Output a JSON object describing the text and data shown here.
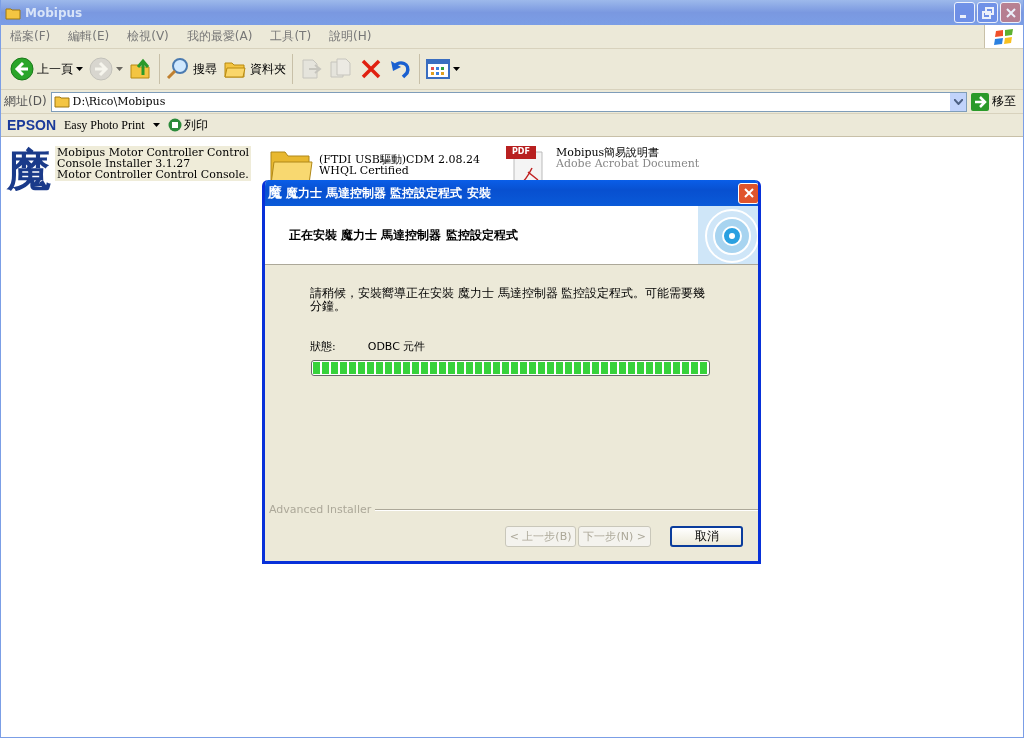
{
  "window": {
    "title": "Mobipus",
    "active": false
  },
  "menu": [
    {
      "label": "檔案(F)"
    },
    {
      "label": "編輯(E)"
    },
    {
      "label": "檢視(V)"
    },
    {
      "label": "我的最愛(A)"
    },
    {
      "label": "工具(T)"
    },
    {
      "label": "說明(H)"
    }
  ],
  "toolbar": [
    {
      "kind": "back",
      "label": "上一頁",
      "disabled": false
    },
    {
      "kind": "forward",
      "disabled": true
    },
    {
      "kind": "up",
      "disabled": false
    },
    {
      "kind": "search",
      "label": "搜尋",
      "disabled": false
    },
    {
      "kind": "folders",
      "label": "資料夾",
      "disabled": false
    },
    {
      "kind": "move",
      "disabled": true
    },
    {
      "kind": "copy",
      "disabled": true
    },
    {
      "kind": "delete",
      "disabled": false
    },
    {
      "kind": "undo",
      "disabled": false
    },
    {
      "kind": "views",
      "disabled": false
    }
  ],
  "address": {
    "label": "網址(D)",
    "value": "D:\\Rico\\Mobipus",
    "go": "移至"
  },
  "epson_bar": {
    "brand": "EPSON",
    "menu": "Easy Photo Print",
    "print": "列印"
  },
  "files": [
    {
      "kind": "app",
      "icon_glyph": "魔",
      "lines": [
        "Mobipus Motor Controller Control",
        "Console Installer 3.1.27",
        "Motor Controller Control Console."
      ],
      "selected": true
    },
    {
      "kind": "folder",
      "lines": [
        "(FTDI USB驅動)CDM 2.08.24",
        "WHQL Certified"
      ],
      "selected": false
    },
    {
      "kind": "pdf",
      "icon_label": "PDF",
      "lines": [
        "Mobipus簡易說明書",
        "Adobe Acrobat Document"
      ],
      "selected": false
    }
  ],
  "dialog": {
    "title": "魔力士 馬達控制器 監控設定程式 安裝",
    "icon_glyph": "魔",
    "active": true,
    "heading": "正在安裝 魔力士 馬達控制器 監控設定程式",
    "message": "請稍候，安裝嚮導正在安裝 魔力士 馬達控制器 監控設定程式。可能需要幾分鐘。",
    "status_label": "狀態:",
    "status_value": "ODBC 元件",
    "progress": {
      "level": 1
    },
    "brand": "Advanced Installer",
    "buttons": [
      {
        "label": "< 上一步(B)",
        "disabled": true,
        "default": false
      },
      {
        "label": "下一步(N) >",
        "disabled": true,
        "default": false
      },
      {
        "label": "取消",
        "disabled": false,
        "default": true
      }
    ]
  }
}
